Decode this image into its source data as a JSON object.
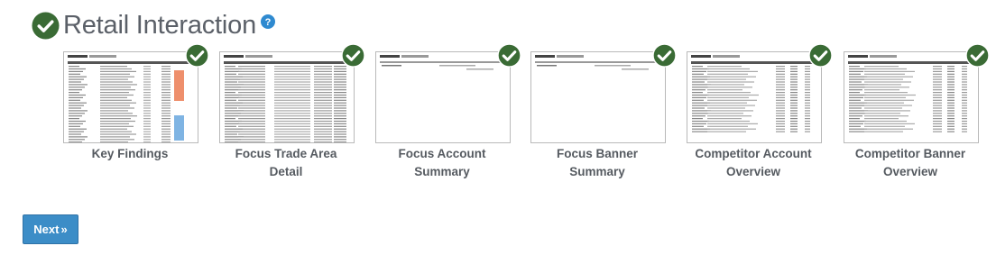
{
  "page": {
    "title": "Retail Interaction"
  },
  "colors": {
    "check": "#3a6b35",
    "help": "#2f8ad0",
    "button": "#3c8dc7"
  },
  "icons": {
    "complete": "check-circle-icon",
    "help": "question-circle-icon",
    "next": "double-chevron-right-icon"
  },
  "reports": [
    {
      "label": "Key Findings",
      "status": "complete"
    },
    {
      "label": "Focus Trade Area Detail",
      "status": "complete"
    },
    {
      "label": "Focus Account Summary",
      "status": "complete"
    },
    {
      "label": "Focus Banner Summary",
      "status": "complete"
    },
    {
      "label": "Competitor Account Overview",
      "status": "complete"
    },
    {
      "label": "Competitor Banner Overview",
      "status": "complete"
    }
  ],
  "next_button": {
    "label": "Next",
    "icon": "»"
  }
}
